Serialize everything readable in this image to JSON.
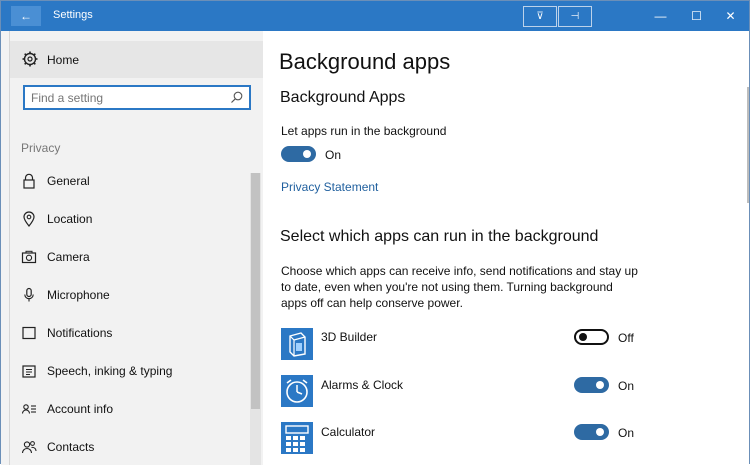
{
  "window": {
    "title": "Settings",
    "back_glyph": "←",
    "min_glyph": "—",
    "max_glyph": "☐",
    "close_glyph": "✕",
    "extra1_glyph": "⊽",
    "extra2_glyph": "⊣"
  },
  "sidebar": {
    "home_label": "Home",
    "search_placeholder": "Find a setting",
    "section_label": "Privacy",
    "items": [
      {
        "label": "General",
        "icon": "lock-icon"
      },
      {
        "label": "Location",
        "icon": "location-icon"
      },
      {
        "label": "Camera",
        "icon": "camera-icon"
      },
      {
        "label": "Microphone",
        "icon": "microphone-icon"
      },
      {
        "label": "Notifications",
        "icon": "notifications-icon"
      },
      {
        "label": "Speech, inking & typing",
        "icon": "speech-icon"
      },
      {
        "label": "Account info",
        "icon": "account-info-icon"
      },
      {
        "label": "Contacts",
        "icon": "contacts-icon"
      }
    ]
  },
  "main": {
    "title": "Background apps",
    "subtitle": "Background Apps",
    "run_label": "Let apps run in the background",
    "run_state": "On",
    "privacy_link": "Privacy Statement",
    "select_heading": "Select which apps can run in the background",
    "description": "Choose which apps can receive info, send notifications and stay up to date, even when you're not using them. Turning background apps off can help conserve power.",
    "apps": [
      {
        "name": "3D Builder",
        "state": "Off",
        "icon": "3d-builder-icon"
      },
      {
        "name": "Alarms & Clock",
        "state": "On",
        "icon": "alarms-clock-icon"
      },
      {
        "name": "Calculator",
        "state": "On",
        "icon": "calculator-icon"
      }
    ]
  },
  "colors": {
    "accent": "#2b78c5",
    "toggle_on": "#2e6aa3",
    "link": "#1f5f9e"
  }
}
